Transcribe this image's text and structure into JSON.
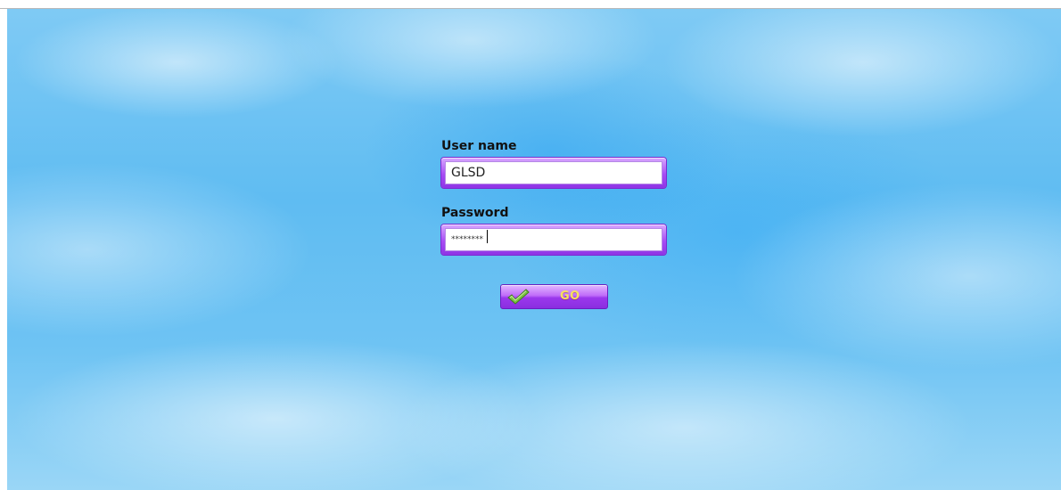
{
  "login_form": {
    "username_label": "User name",
    "username_value": "GLSD",
    "password_label": "Password",
    "password_value": "********",
    "go_label": "GO"
  },
  "icons": {
    "go_button_icon": "checkmark-icon"
  },
  "colors": {
    "sky_blue": "#5fbcf2",
    "field_purple": "#a74cf4",
    "button_purple": "#9b38ec",
    "go_text_yellow": "#f6e15b",
    "checkmark_green": "#7cc142"
  }
}
